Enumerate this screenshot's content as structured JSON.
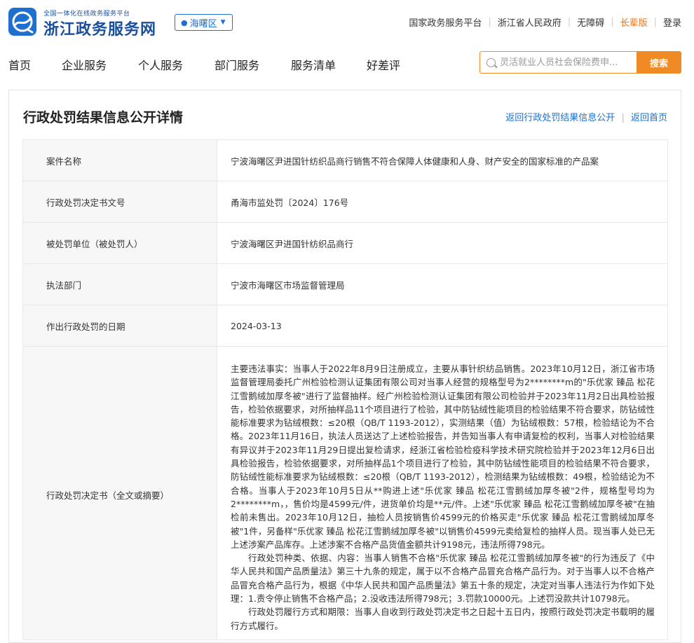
{
  "header": {
    "logo_subtitle": "全国一体化在线政务服务平台",
    "logo_title": "浙江政务服务网",
    "region": "海曙区",
    "top_links": [
      {
        "label": "国家政务服务平台"
      },
      {
        "label": "浙江省人民政府"
      },
      {
        "label": "无障碍"
      },
      {
        "label": "长辈版"
      },
      {
        "label": "登录"
      }
    ]
  },
  "nav": {
    "items": [
      "首页",
      "企业服务",
      "个人服务",
      "部门服务",
      "服务清单",
      "好差评"
    ],
    "search_placeholder": "灵活就业人员社会保险费申...",
    "search_button": "搜索"
  },
  "page": {
    "title": "行政处罚结果信息公开详情",
    "back_list": "返回行政处罚结果信息公开",
    "back_home": "返回首页"
  },
  "details": {
    "case_name_label": "案件名称",
    "case_name": "宁波海曙区尹进国针纺织品商行销售不符合保障人体健康和人身、财产安全的国家标准的产品案",
    "decision_no_label": "行政处罚决定书文号",
    "decision_no": "甬海市监处罚〔2024〕176号",
    "party_label": "被处罚单位（被处罚人）",
    "party": "宁波海曙区尹进国针纺织品商行",
    "dept_label": "执法部门",
    "dept": "宁波市海曙区市场监督管理局",
    "date_label": "作出行政处罚的日期",
    "date": "2024-03-13",
    "decision_label": "行政处罚决定书（全文或摘要）",
    "decision_p1": "主要违法事实：当事人于2022年8月9日注册成立，主要从事针织纺品销售。2023年10月12日，浙江省市场监督管理局委托广州检验检测认证集团有限公司对当事人经营的规格型号为2********m的\"乐优家 臻品 松花江雪鹅绒加厚冬被\"进行了监督抽样。经广州检验检测认证集团有限公司检验并于2023年11月2日出具检验报告，检验依据要求，对所抽样品11个项目进行了检验，其中防钻绒性能项目的检验结果不符合要求，防钻绒性能标准要求为钻绒根数：≤20根（QB/T 1193-2012），实测结果（值）为钻绒根数：57根，检验结论为不合格。2023年11月16日，执法人员送达了上述检验报告，并告知当事人有申请复检的权利，当事人对检验结果有异议并于2023年11月29日提出复检请求，经浙江省检验检疫科学技术研究院检验并于2023年12月6日出具检验报告，检验依据要求，对所抽样品1个项目进行了检验，其中防钻绒性能项目的检验结果不符合要求，防钻绒性能标准要求为钻绒根数：≤20根（QB/T 1193-2012），检测结果为钻绒根数：49根，检验结论为不合格。当事人于2023年10月5日从**购进上述\"乐优家 臻品 松花江雪鹅绒加厚冬被\"2件，规格型号均为2********m，，售价均是4599元/件，进货单价均是**元/件。上述\"乐优家 臻品 松花江雪鹅绒加厚冬被\"在抽检前未售出。2023年10月12日，抽检人员按销售价4599元的价格买走\"乐优家 臻品 松花江雪鹅绒加厚冬被\"1件，另备样\"乐优家 臻品 松花江雪鹅绒加厚冬被\"以销售价4599元卖给复检的抽样人员。现当事人处已无上述涉案产品库存。上述涉案不合格产品货值金额共计9198元，违法所得798元。",
    "decision_p2": "行政处罚种类、依据、内容：当事人销售不合格\"乐优家 臻品 松花江雪鹅绒加厚冬被\"的行为违反了《中华人民共和国产品质量法》第三十九条的规定，属于以不合格产品冒充合格产品行为。对于当事人以不合格产品冒充合格产品行为，根据《中华人民共和国产品质量法》第五十条的规定，决定对当事人违法行为作如下处理：1.责令停止销售不合格产品；2.没收违法所得798元；3.罚款10000元。上述罚没款共计10798元。",
    "decision_p3": "行政处罚履行方式和期限：当事人自收到行政处罚决定书之日起十五日内，按照行政处罚决定书载明的履行方式履行。"
  },
  "colors": {
    "brand_blue": "#1a4f9c",
    "link_blue": "#1f6fd1",
    "accent_orange": "#f08a24"
  },
  "icons": [
    "zhejiang-logo-icon",
    "location-pin-icon",
    "caret-down-icon",
    "search-icon"
  ]
}
